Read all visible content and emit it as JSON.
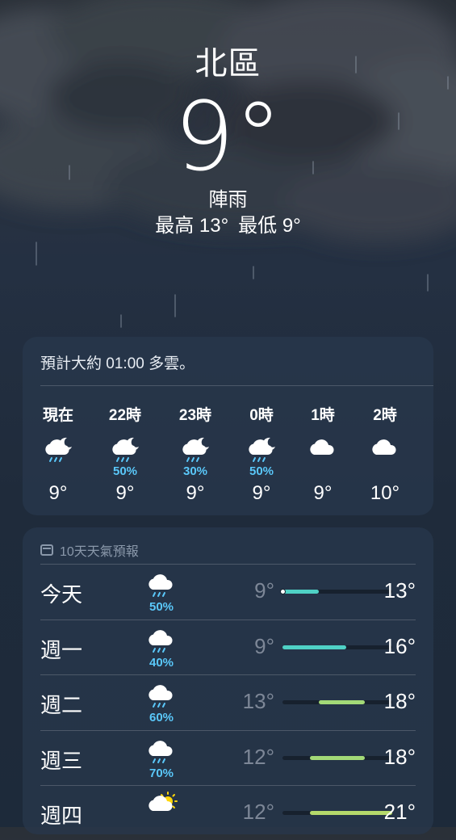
{
  "location": {
    "city": "北區",
    "temperature": "9°",
    "condition": "陣雨",
    "high": "最高 13°",
    "low": "最低 9°"
  },
  "hourly": {
    "summary": "預計大約 01:00 多雲。",
    "hours": [
      {
        "label": "現在",
        "icon": "cloud-moon-rain-icon",
        "precip": "",
        "temp": "9°"
      },
      {
        "label": "22時",
        "icon": "cloud-moon-rain-icon",
        "precip": "50%",
        "temp": "9°"
      },
      {
        "label": "23時",
        "icon": "cloud-moon-rain-icon",
        "precip": "30%",
        "temp": "9°"
      },
      {
        "label": "0時",
        "icon": "cloud-moon-rain-icon",
        "precip": "50%",
        "temp": "9°"
      },
      {
        "label": "1時",
        "icon": "cloud-icon",
        "precip": "",
        "temp": "9°"
      },
      {
        "label": "2時",
        "icon": "cloud-icon",
        "precip": "",
        "temp": "10°"
      }
    ]
  },
  "daily": {
    "title": "10天天氣預報",
    "range_min": 9,
    "range_max": 21,
    "current_temp": 9,
    "days": [
      {
        "day": "今天",
        "icon": "cloud-rain-icon",
        "precip": "50%",
        "low": "9°",
        "high": "13°",
        "low_val": 9,
        "high_val": 13,
        "color": "#4fd1c5"
      },
      {
        "day": "週一",
        "icon": "cloud-rain-icon",
        "precip": "40%",
        "low": "9°",
        "high": "16°",
        "low_val": 9,
        "high_val": 16,
        "color": "#4fd1c5"
      },
      {
        "day": "週二",
        "icon": "cloud-rain-icon",
        "precip": "60%",
        "low": "13°",
        "high": "18°",
        "low_val": 13,
        "high_val": 18,
        "color": "#a3d977"
      },
      {
        "day": "週三",
        "icon": "cloud-rain-icon",
        "precip": "70%",
        "low": "12°",
        "high": "18°",
        "low_val": 12,
        "high_val": 18,
        "color": "#a3d977"
      },
      {
        "day": "週四",
        "icon": "cloud-sun-icon",
        "precip": "",
        "low": "12°",
        "high": "21°",
        "low_val": 12,
        "high_val": 21,
        "color": "#b5d96b"
      }
    ]
  }
}
